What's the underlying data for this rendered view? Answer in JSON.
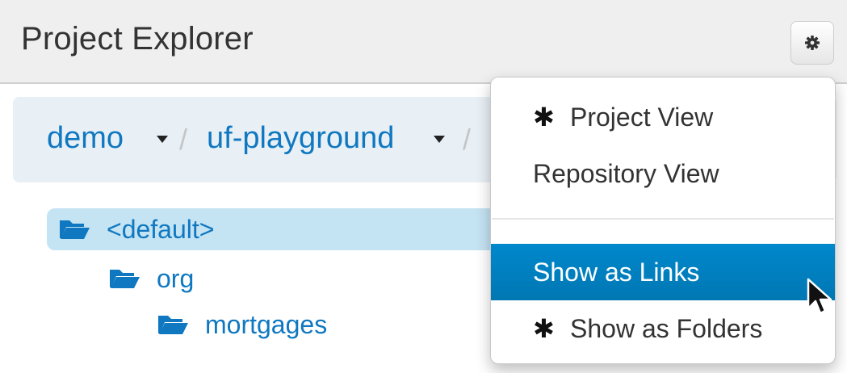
{
  "header": {
    "title": "Project Explorer"
  },
  "breadcrumb": {
    "items": [
      "demo",
      "uf-playground"
    ],
    "separator": "/"
  },
  "tree": {
    "items": [
      {
        "label": "<default>",
        "selected": true
      },
      {
        "label": "org",
        "selected": false
      },
      {
        "label": "mortgages",
        "selected": false
      }
    ]
  },
  "menu": {
    "items": [
      {
        "label": "Project View",
        "checked": true
      },
      {
        "label": "Repository View",
        "checked": false
      },
      {
        "label": "Show as Links",
        "checked": false,
        "highlighted": true
      },
      {
        "label": "Show as Folders",
        "checked": true
      }
    ],
    "check_glyph": "✱"
  },
  "colors": {
    "link": "#0f78c0",
    "highlight": "#0081c2",
    "selected_row": "#c4e3f3",
    "breadcrumb_bg": "#e8f0f6"
  }
}
